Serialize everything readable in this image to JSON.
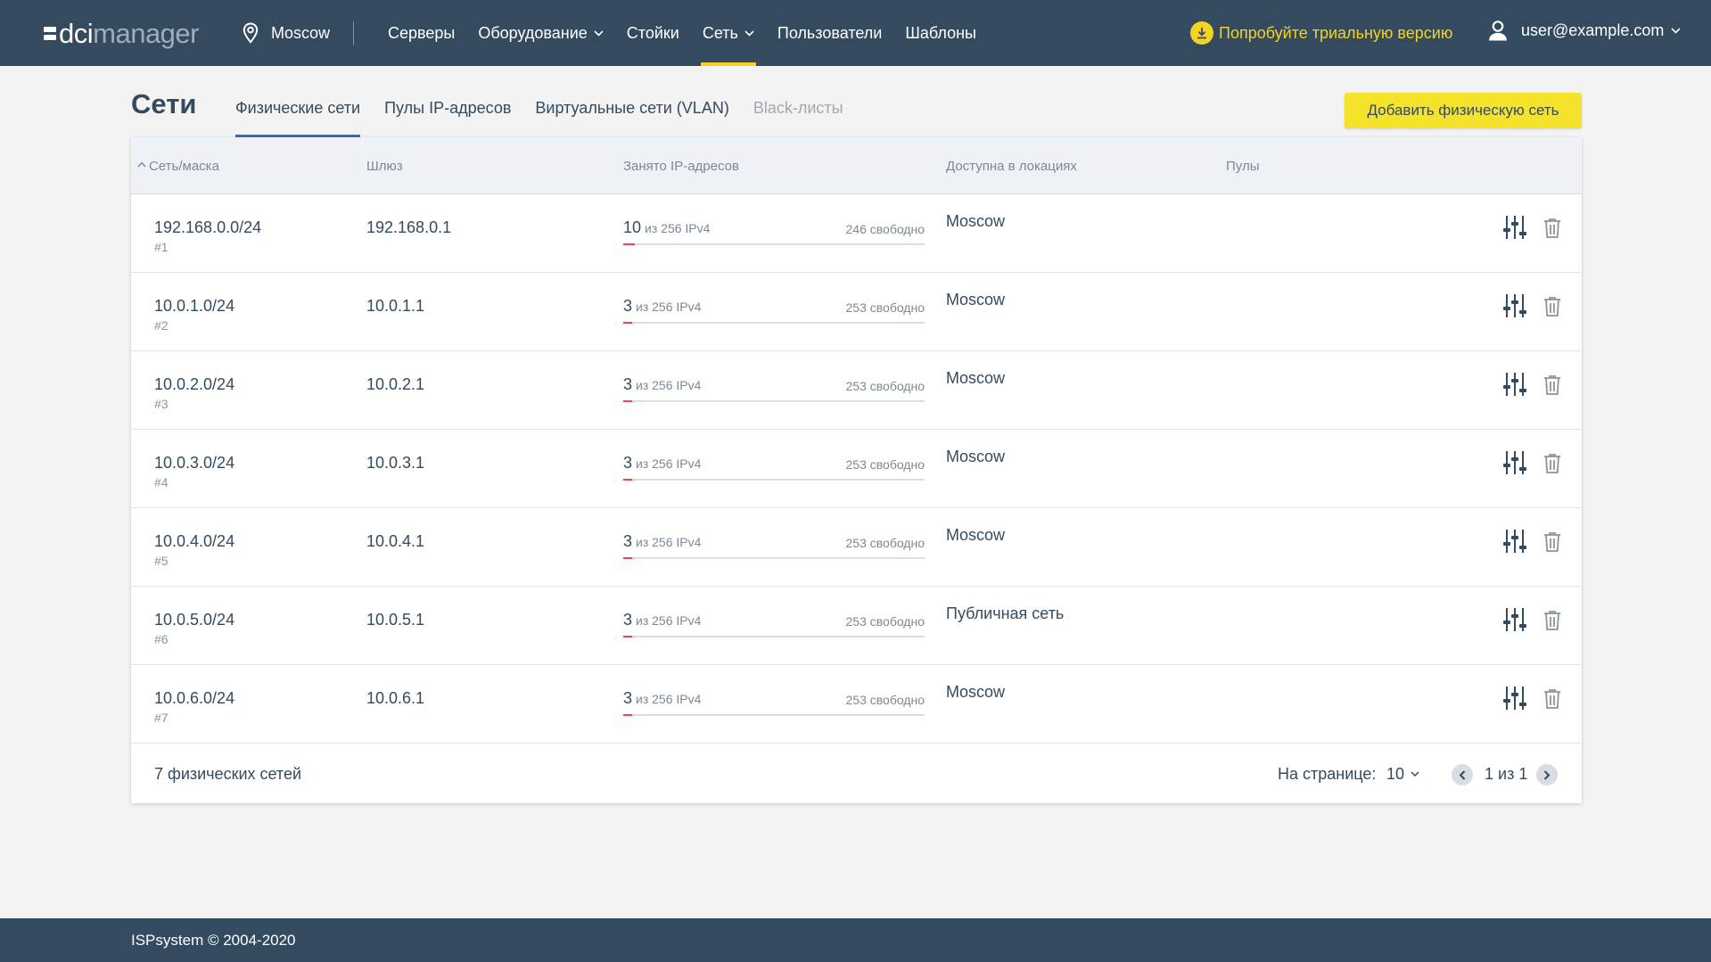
{
  "logo": {
    "part1": "dci",
    "part2": "manager"
  },
  "location": {
    "label": "Moscow"
  },
  "nav": [
    {
      "label": "Серверы",
      "dropdown": false,
      "active": false
    },
    {
      "label": "Оборудование",
      "dropdown": true,
      "active": false
    },
    {
      "label": "Стойки",
      "dropdown": false,
      "active": false
    },
    {
      "label": "Сеть",
      "dropdown": true,
      "active": true
    },
    {
      "label": "Пользователи",
      "dropdown": false,
      "active": false
    },
    {
      "label": "Шаблоны",
      "dropdown": false,
      "active": false
    }
  ],
  "trial": {
    "label": "Попробуйте триальную версию"
  },
  "user": {
    "label": "user@example.com"
  },
  "page": {
    "title": "Сети"
  },
  "tabs": [
    {
      "label": "Физические сети",
      "active": true,
      "disabled": false
    },
    {
      "label": "Пулы IP-адресов",
      "active": false,
      "disabled": false
    },
    {
      "label": "Виртуальные сети (VLAN)",
      "active": false,
      "disabled": false
    },
    {
      "label": "Black-листы",
      "active": false,
      "disabled": true
    }
  ],
  "add_button": {
    "label": "Добавить физическую сеть"
  },
  "table": {
    "headers": {
      "network": "Сеть/маска",
      "gateway": "Шлюз",
      "ips": "Занято IP-адресов",
      "locations": "Доступна в локациях",
      "pools": "Пулы"
    },
    "rows": [
      {
        "network": "192.168.0.0/24",
        "id": "#1",
        "gateway": "192.168.0.1",
        "used": "10",
        "total": "из 256 IPv4",
        "free": "246 свободно",
        "used_fraction": 0.039,
        "location": "Moscow"
      },
      {
        "network": "10.0.1.0/24",
        "id": "#2",
        "gateway": "10.0.1.1",
        "used": "3",
        "total": "из 256 IPv4",
        "free": "253 свободно",
        "used_fraction": 0.012,
        "location": "Moscow"
      },
      {
        "network": "10.0.2.0/24",
        "id": "#3",
        "gateway": "10.0.2.1",
        "used": "3",
        "total": "из 256 IPv4",
        "free": "253 свободно",
        "used_fraction": 0.012,
        "location": "Moscow"
      },
      {
        "network": "10.0.3.0/24",
        "id": "#4",
        "gateway": "10.0.3.1",
        "used": "3",
        "total": "из 256 IPv4",
        "free": "253 свободно",
        "used_fraction": 0.012,
        "location": "Moscow"
      },
      {
        "network": "10.0.4.0/24",
        "id": "#5",
        "gateway": "10.0.4.1",
        "used": "3",
        "total": "из 256 IPv4",
        "free": "253 свободно",
        "used_fraction": 0.012,
        "location": "Moscow"
      },
      {
        "network": "10.0.5.0/24",
        "id": "#6",
        "gateway": "10.0.5.1",
        "used": "3",
        "total": "из 256 IPv4",
        "free": "253 свободно",
        "used_fraction": 0.012,
        "location": "Публичная сеть"
      },
      {
        "network": "10.0.6.0/24",
        "id": "#7",
        "gateway": "10.0.6.1",
        "used": "3",
        "total": "из 256 IPv4",
        "free": "253 свободно",
        "used_fraction": 0.012,
        "location": "Moscow"
      }
    ],
    "footer": {
      "total": "7 физических сетей",
      "per_page_label": "На странице:",
      "per_page_value": "10",
      "page_label": "1 из 1"
    }
  },
  "icons": {
    "location": "map-pin-icon",
    "trial": "download-icon",
    "user": "user-icon",
    "settings": "sliders-icon",
    "delete": "trash-icon",
    "sort": "sort-asc-icon",
    "prev": "chevron-left-icon",
    "next": "chevron-right-icon"
  },
  "colors": {
    "header_bg": "#344a5e",
    "accent_yellow": "#f5d322",
    "tab_underline": "#2f73b8",
    "usage_bar": "#ff3d52"
  },
  "copyright": "ISPsystem © 2004-2020"
}
